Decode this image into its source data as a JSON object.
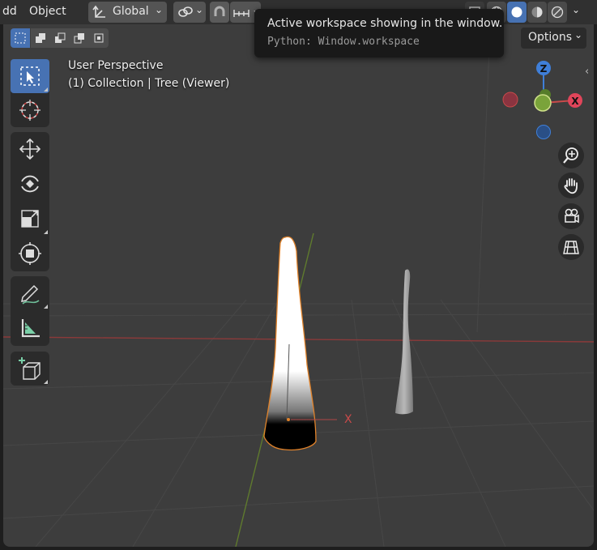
{
  "header": {
    "menu_partial": "dd",
    "menu_object": "Object",
    "orientation": "Global"
  },
  "tooltip": {
    "title": "Active workspace showing in the window.",
    "python": "Python: Window.workspace"
  },
  "viewport": {
    "perspective": "User Perspective",
    "collection": "(1) Collection | Tree (Viewer)",
    "options_label": "Options",
    "axis_x": "X",
    "gizmo": {
      "z": "Z",
      "x": "X"
    }
  },
  "colors": {
    "active_tool": "#4772b3",
    "axis_x": "#c94a4a",
    "axis_y": "#7aa33a",
    "axis_z": "#3f7fd9"
  }
}
